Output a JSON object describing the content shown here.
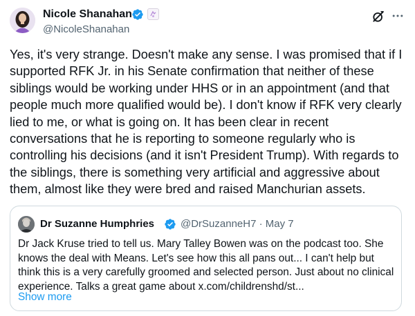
{
  "author": {
    "name": "Nicole Shanahan",
    "handle": "@NicoleShanahan",
    "verified_color": "#1d9bf0"
  },
  "tweet": {
    "text": "Yes, it's very strange. Doesn't make any sense. I was promised that if I supported RFK Jr. in his Senate confirmation that neither of these siblings would be working under HHS or in an appointment (and that people much more qualified would be). I don't know if RFK very clearly lied to me, or what is going on. It has been clear in recent conversations that he is reporting to someone regularly who is controlling his decisions (and it isn't President Trump). With regards to the siblings, there is something very artificial and aggressive about them, almost like they were bred and raised Manchurian assets."
  },
  "quote": {
    "author_name": "Dr Suzanne Humphries",
    "meta": "@DrSuzanneH7 · May 7",
    "text": "Dr Jack Kruse tried to tell us. Mary Talley Bowen was on the podcast too. She knows the deal with Means. Let's see how this all pans out... I can't help but think this is a very carefully groomed and selected person. Just about no clinical experience. Talks a great game about x.com/childrenshd/st...",
    "show_more": "Show more"
  },
  "icons": {
    "grok": "grok-icon",
    "more": "more-options-icon",
    "verified": "verified-badge-icon"
  },
  "colors": {
    "link": "#1d9bf0",
    "secondary_text": "#536471",
    "border": "#cfd9de"
  }
}
